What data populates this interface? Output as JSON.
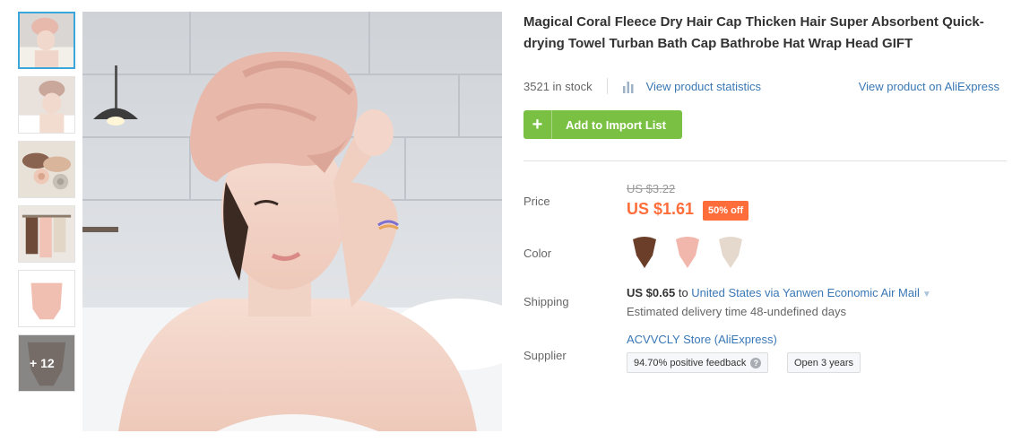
{
  "gallery": {
    "thumbnails": [
      {
        "icon": "towel-head-thumbnail"
      },
      {
        "icon": "towel-head-thumbnail"
      },
      {
        "icon": "rolled-towels-thumbnail"
      },
      {
        "icon": "hanging-towels-thumbnail"
      },
      {
        "icon": "pink-towel-thumbnail"
      },
      {
        "icon": "brown-towel-thumbnail"
      }
    ],
    "more_count": "+ 12",
    "main_image": "woman-wearing-pink-towel-cap"
  },
  "product": {
    "title": "Magical Coral Fleece Dry Hair Cap Thicken Hair Super Absorbent Quick-drying Towel Turban Bath Cap Bathrobe Hat Wrap Head GIFT",
    "stock": "3521 in stock",
    "stats_link": "View product statistics",
    "aliexpress_link": "View product on AliExpress",
    "add_button": "Add to Import List",
    "add_icon": "+"
  },
  "price": {
    "label": "Price",
    "old": "US $3.22",
    "current": "US $1.61",
    "discount": "50% off"
  },
  "color": {
    "label": "Color",
    "swatches": [
      {
        "name": "brown",
        "hex": "#6b3e2a"
      },
      {
        "name": "pink",
        "hex": "#f2b7ac"
      },
      {
        "name": "beige",
        "hex": "#e4d9cc"
      }
    ]
  },
  "shipping": {
    "label": "Shipping",
    "cost": "US $0.65",
    "to": "to",
    "method": "United States via Yanwen Economic Air Mail",
    "estimate": "Estimated delivery time 48-undefined days"
  },
  "supplier": {
    "label": "Supplier",
    "store": "ACVVCLY Store (AliExpress)",
    "feedback": "94.70% positive feedback",
    "help_icon": "?",
    "open": "Open 3 years"
  },
  "colors": {
    "accent_green": "#7ac143",
    "link_blue": "#3a78b5",
    "price_orange": "#ff6d3a",
    "thumb_active": "#3aa6d9"
  }
}
